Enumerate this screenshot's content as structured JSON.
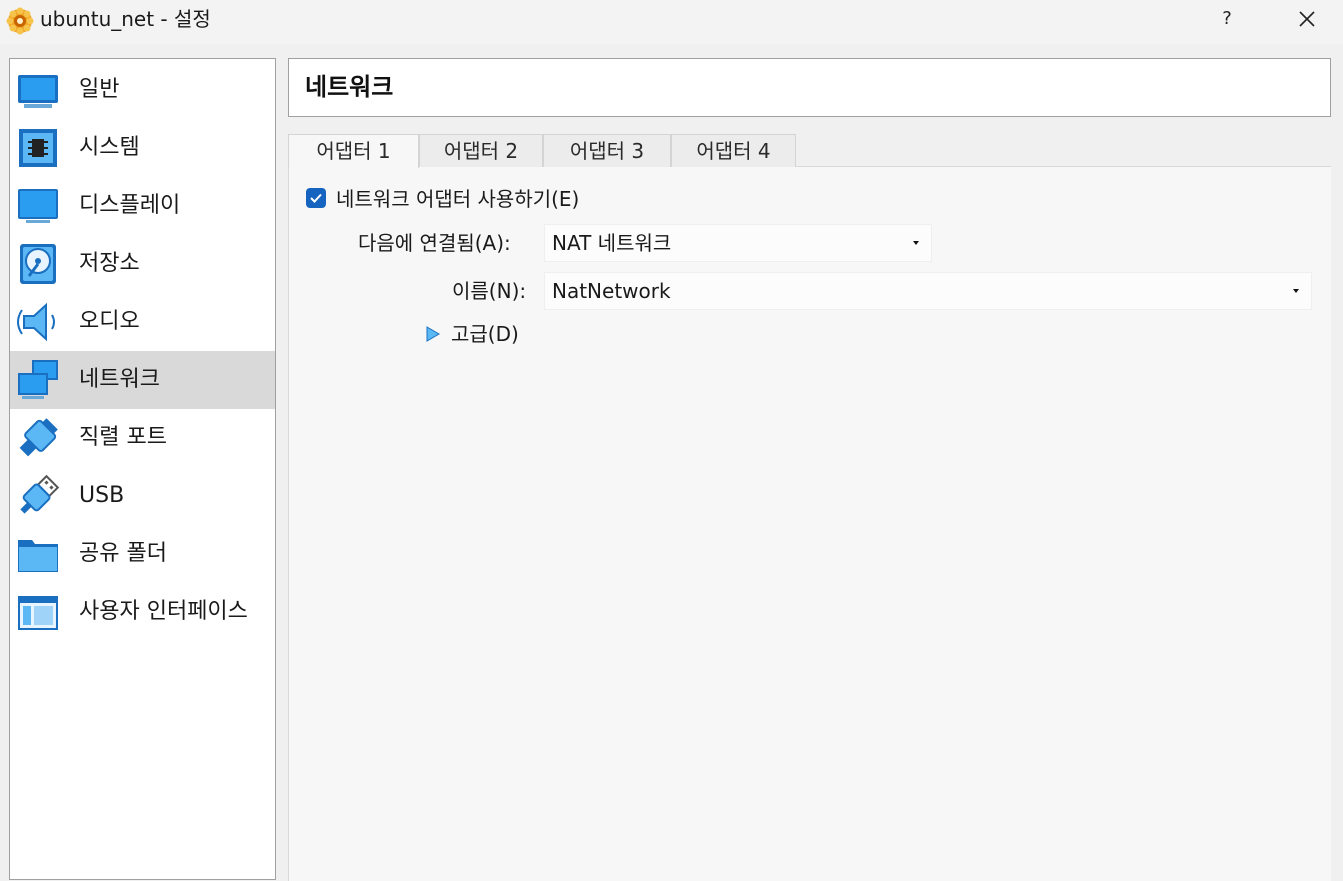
{
  "window": {
    "title": "ubuntu_net - 설정",
    "help_label": "?",
    "icons": {
      "app": "virtualbox-gear-icon",
      "close": "close-icon"
    }
  },
  "sidebar": {
    "items": [
      {
        "label": "일반",
        "icon": "general-monitor-icon",
        "selected": false
      },
      {
        "label": "시스템",
        "icon": "system-chip-icon",
        "selected": false
      },
      {
        "label": "디스플레이",
        "icon": "display-monitor-icon",
        "selected": false
      },
      {
        "label": "저장소",
        "icon": "storage-disk-icon",
        "selected": false
      },
      {
        "label": "오디오",
        "icon": "audio-speaker-icon",
        "selected": false
      },
      {
        "label": "네트워크",
        "icon": "network-icon",
        "selected": true
      },
      {
        "label": "직렬 포트",
        "icon": "serial-port-icon",
        "selected": false
      },
      {
        "label": "USB",
        "icon": "usb-icon",
        "selected": false
      },
      {
        "label": "공유 폴더",
        "icon": "shared-folder-icon",
        "selected": false
      },
      {
        "label": "사용자 인터페이스",
        "icon": "user-interface-icon",
        "selected": false
      }
    ]
  },
  "main": {
    "title": "네트워크",
    "tabs": [
      {
        "label": "어댑터 1",
        "active": true
      },
      {
        "label": "어댑터 2",
        "active": false
      },
      {
        "label": "어댑터 3",
        "active": false
      },
      {
        "label": "어댑터 4",
        "active": false
      }
    ],
    "enable_adapter": {
      "label": "네트워크 어댑터 사용하기(E)",
      "checked": true
    },
    "attached_to": {
      "label": "다음에 연결됨(A):",
      "value": "NAT 네트워크"
    },
    "name": {
      "label": "이름(N):",
      "value": "NatNetwork"
    },
    "advanced": {
      "label": "고급(D)",
      "expanded": false
    }
  },
  "colors": {
    "accent": "#1565c0",
    "selection": "#d9d9d9",
    "icon_blue": "#1e90e0"
  }
}
